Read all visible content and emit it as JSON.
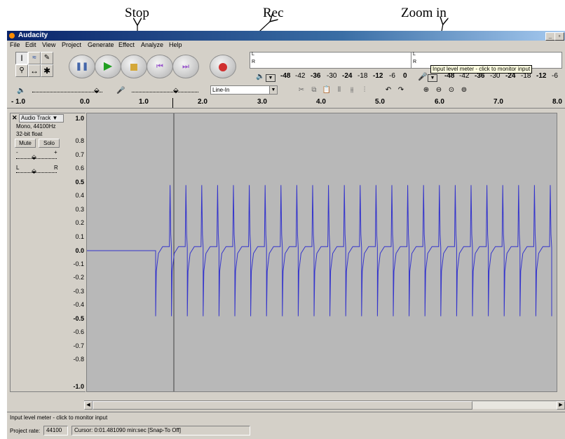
{
  "annotations": {
    "stop": "Stop",
    "rec": "Rec",
    "zoom_in": "Zoom in"
  },
  "window": {
    "title": "Audacity"
  },
  "menu": [
    "File",
    "Edit",
    "View",
    "Project",
    "Generate",
    "Effect",
    "Analyze",
    "Help"
  ],
  "meters": {
    "output_left": "L",
    "output_right": "R",
    "input_left": "L",
    "input_right": "R",
    "scale": [
      "-48",
      "-42",
      "-36",
      "-30",
      "-24",
      "-18",
      "-12",
      "-6",
      "0"
    ],
    "input_scale": [
      "-48",
      "-42",
      "-36",
      "-30",
      "-24",
      "-18",
      "-12",
      "-6"
    ]
  },
  "tooltip": "Input level meter - click to monitor input",
  "mixer": {
    "input_source": "Line-In"
  },
  "ruler": {
    "labels": [
      "- 1.0",
      "0.0",
      "1.0",
      "2.0",
      "3.0",
      "4.0",
      "5.0",
      "6.0",
      "7.0",
      "8.0"
    ]
  },
  "track": {
    "name": "Audio Track",
    "format": "Mono, 44100Hz",
    "bit_depth": "32-bit float",
    "mute": "Mute",
    "solo": "Solo",
    "gain_minus": "-",
    "gain_plus": "+",
    "pan_left": "L",
    "pan_right": "R"
  },
  "amplitude_labels": [
    "1.0",
    "0.8",
    "0.7",
    "0.6",
    "0.5",
    "0.4",
    "0.3",
    "0.2",
    "0.1",
    "0.0",
    "-0.1",
    "-0.2",
    "-0.3",
    "-0.4",
    "-0.5",
    "-0.6",
    "-0.7",
    "-0.8",
    "-1.0"
  ],
  "status": {
    "message": "Input level meter - click to monitor input",
    "project_rate_label": "Project rate:",
    "project_rate_value": "44100",
    "cursor": "Cursor: 0:01.481090 min:sec  [Snap-To Off]"
  },
  "colors": {
    "waveform": "#3333cc",
    "wave_bg": "#b8b8b8",
    "title_bar": "#0a246a"
  }
}
